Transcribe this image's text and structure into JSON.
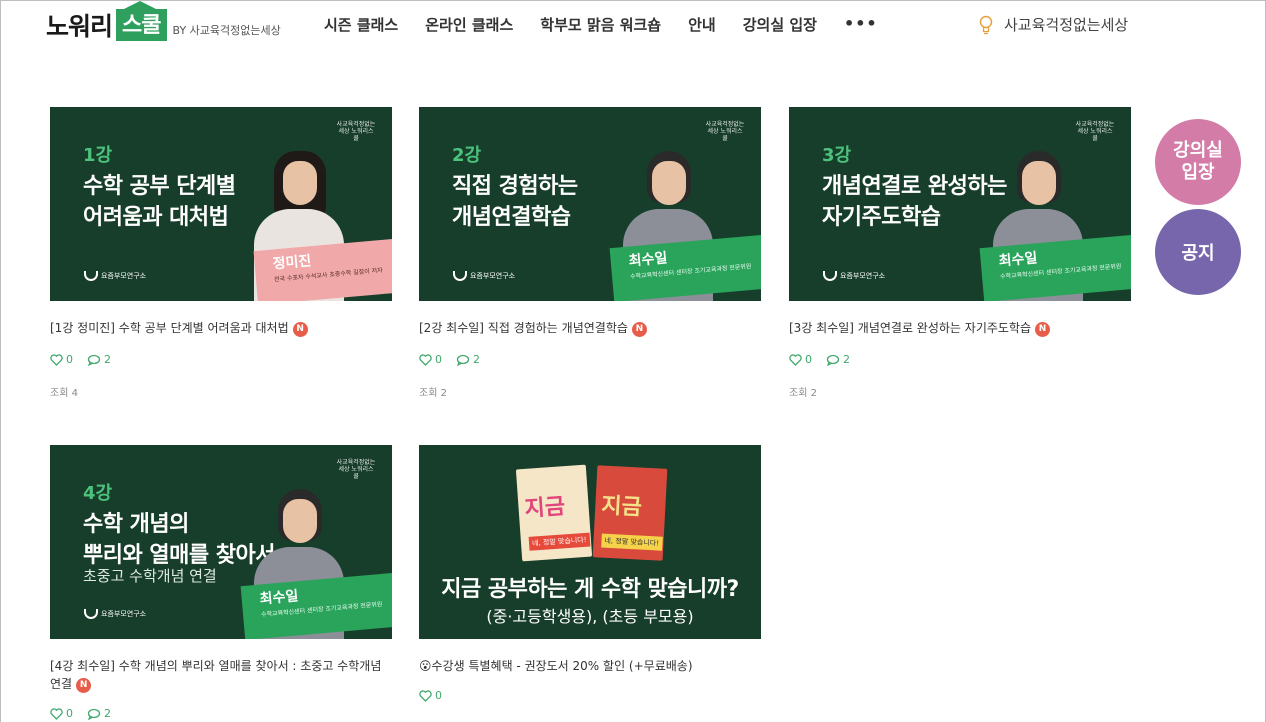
{
  "header": {
    "logo_main": "노워리",
    "logo_house": "스쿨",
    "logo_by": "BY 사교육걱정없는세상",
    "nav": [
      "시즌 클래스",
      "온라인 클래스",
      "학부모 맑음 워크숍",
      "안내",
      "강의실 입장"
    ],
    "more": "•••",
    "user_name": "사교육걱정없는세상"
  },
  "cards": [
    {
      "lecture": "1강",
      "thumb_title": "수학 공부 단계별\n어려움과 대처법",
      "thumb_sub": "",
      "speaker": "정미진",
      "speaker_desc": "전국 수포자 수석교사 초중수학 길잡이 저자",
      "title": "[1강 정미진] 수학 공부 단계별 어려움과 대처법",
      "badge": "N",
      "likes": "0",
      "comments": "2",
      "views": "조회 4"
    },
    {
      "lecture": "2강",
      "thumb_title": "직접 경험하는\n개념연결학습",
      "thumb_sub": "",
      "speaker": "최수일",
      "speaker_desc": "수학교육혁신센터 센터장 조기교육과정 전문위원",
      "title": "[2강 최수일] 직접 경험하는 개념연결학습",
      "badge": "N",
      "likes": "0",
      "comments": "2",
      "views": "조회 2"
    },
    {
      "lecture": "3강",
      "thumb_title": "개념연결로 완성하는\n자기주도학습",
      "thumb_sub": "",
      "speaker": "최수일",
      "speaker_desc": "수학교육혁신센터 센터장 조기교육과정 전문위원",
      "title": "[3강 최수일] 개념연결로 완성하는 자기주도학습",
      "badge": "N",
      "likes": "0",
      "comments": "2",
      "views": "조회 2"
    },
    {
      "lecture": "4강",
      "thumb_title": "수학 개념의\n뿌리와 열매를 찾아서",
      "thumb_sub": "초중고 수학개념 연결",
      "speaker": "최수일",
      "speaker_desc": "수학교육혁신센터 센터장 조기교육과정 전문위원",
      "title": "[4강 최수일] 수학 개념의 뿌리와 열매를 찾아서 : 초중고 수학개념 연결",
      "badge": "N",
      "likes": "0",
      "comments": "2",
      "views": ""
    }
  ],
  "promo": {
    "book1_title": "지금",
    "book1_sticker": "네, 정말 맞습니다!",
    "book2_title": "지금",
    "book2_sticker": "네, 정말 맞습니다!",
    "headline": "지금 공부하는 게 수학 맞습니까?",
    "subline": "(중·고등학생용), (초등 부모용)",
    "title": "😮수강생 특별혜택 - 권장도서 20% 할인 (+무료배송)",
    "likes": "0"
  },
  "thumb_brand": "요즘부모연구소",
  "thumb_stamp": "사교육걱정없는세상 노워리스쿨",
  "floating": {
    "lecture": "강의실\n입장",
    "notice": "공지"
  },
  "colors": {
    "brand_green": "#2e9f5c",
    "thumb_bg": "#173d2b",
    "lecture_btn": "#d37ca7",
    "notice_btn": "#7766ac",
    "badge": "#e85d4a"
  }
}
